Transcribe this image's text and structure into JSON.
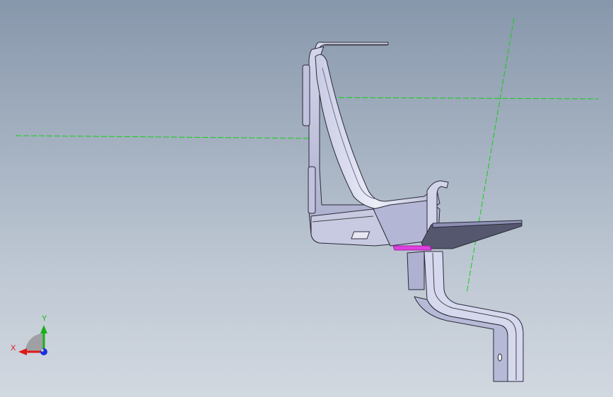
{
  "viewport": {
    "background_top": "#8797ab",
    "background_bottom": "#d2d8e0"
  },
  "model": {
    "part_fill": "#e4e6f2",
    "part_shade": "#b8bbd6",
    "part_dark": "#8d90b4",
    "edge_color": "#2a2a38",
    "face_dark": "#55576e",
    "highlight_face": "#e040e0"
  },
  "reference_lines": {
    "color": "#10d010",
    "style": "dashed"
  },
  "triad": {
    "x_label": "X",
    "y_label": "Y",
    "x_color": "#e01818",
    "y_color": "#18b018",
    "z_color": "#1830e0",
    "origin_icon": "triad-origin-sphere"
  }
}
